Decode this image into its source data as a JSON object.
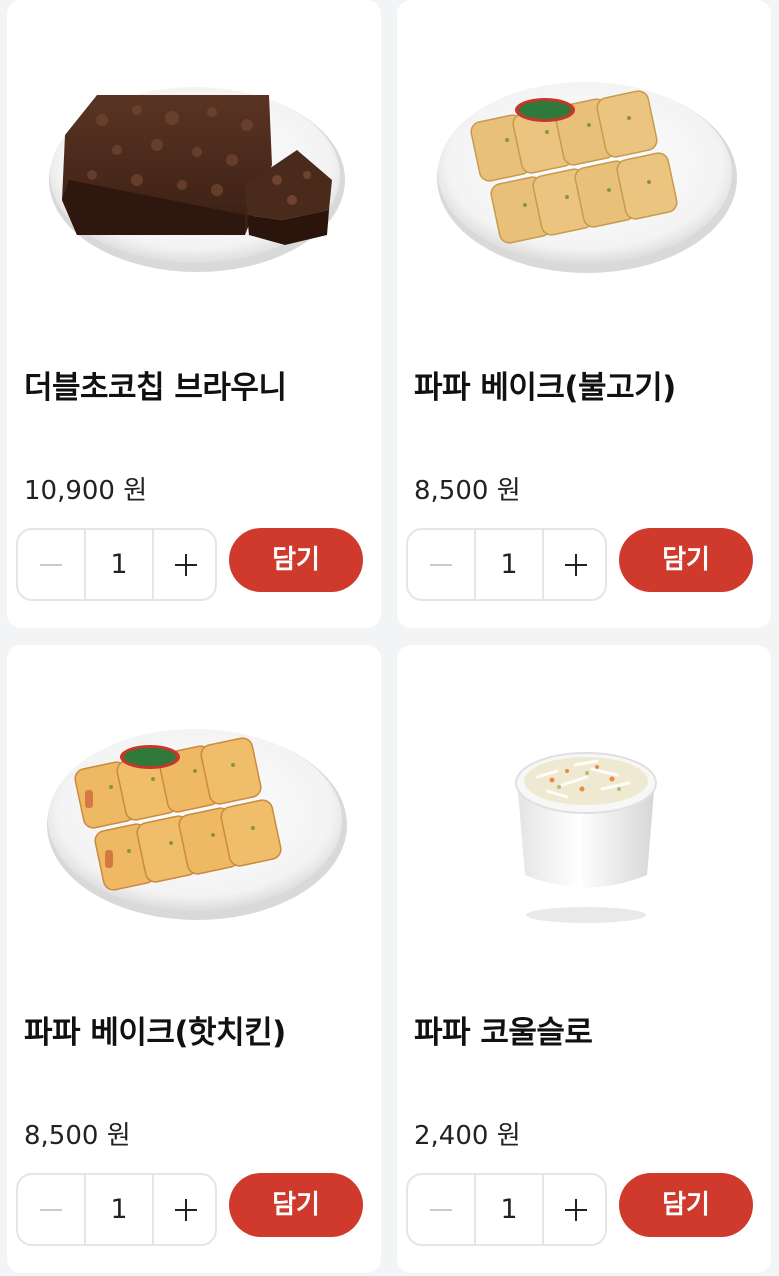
{
  "products": [
    {
      "name": "더블초코칩 브라우니",
      "price": "10,900 원",
      "quantity": "1",
      "add_label": "담기",
      "image_icon": "brownie-plate-image"
    },
    {
      "name": "파파 베이크(불고기)",
      "price": "8,500 원",
      "quantity": "1",
      "add_label": "담기",
      "image_icon": "papa-bake-bulgogi-plate-image"
    },
    {
      "name": "파파 베이크(핫치킨)",
      "price": "8,500 원",
      "quantity": "1",
      "add_label": "담기",
      "image_icon": "papa-bake-hot-chicken-plate-image"
    },
    {
      "name": "파파 코울슬로",
      "price": "2,400 원",
      "quantity": "1",
      "add_label": "담기",
      "image_icon": "coleslaw-cup-image"
    }
  ],
  "colors": {
    "accent": "#cf3a2d",
    "background": "#f2f4f6",
    "card": "#ffffff",
    "border": "#e3e5e8"
  }
}
